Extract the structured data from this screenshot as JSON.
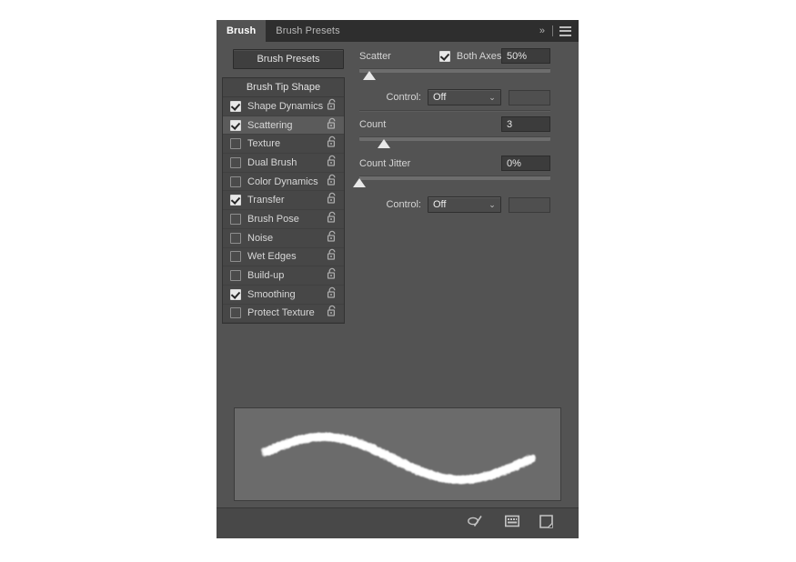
{
  "panel": {
    "tabs": [
      {
        "label": "Brush",
        "active": true
      },
      {
        "label": "Brush Presets",
        "active": false
      }
    ],
    "collapse_icon": "»",
    "menu_icon": "hamburger-menu-icon"
  },
  "left": {
    "presets_button": "Brush Presets",
    "list_header": "Brush Tip Shape",
    "items": [
      {
        "label": "Shape Dynamics",
        "checked": true,
        "selected": false
      },
      {
        "label": "Scattering",
        "checked": true,
        "selected": true
      },
      {
        "label": "Texture",
        "checked": false,
        "selected": false
      },
      {
        "label": "Dual Brush",
        "checked": false,
        "selected": false
      },
      {
        "label": "Color Dynamics",
        "checked": false,
        "selected": false
      },
      {
        "label": "Transfer",
        "checked": true,
        "selected": false
      },
      {
        "label": "Brush Pose",
        "checked": false,
        "selected": false
      },
      {
        "label": "Noise",
        "checked": false,
        "selected": false
      },
      {
        "label": "Wet Edges",
        "checked": false,
        "selected": false
      },
      {
        "label": "Build-up",
        "checked": false,
        "selected": false
      },
      {
        "label": "Smoothing",
        "checked": true,
        "selected": false
      },
      {
        "label": "Protect Texture",
        "checked": false,
        "selected": false
      }
    ]
  },
  "scattering": {
    "scatter": {
      "label": "Scatter",
      "both_axes_label": "Both Axes",
      "both_axes_checked": true,
      "value": "50%",
      "slider_percent": 5
    },
    "scatter_control": {
      "label": "Control:",
      "value": "Off",
      "caret": "⌄",
      "extra_value": ""
    },
    "count": {
      "label": "Count",
      "value": "3",
      "slider_percent": 13
    },
    "count_jitter": {
      "label": "Count Jitter",
      "value": "0%",
      "slider_percent": 0
    },
    "count_control": {
      "label": "Control:",
      "value": "Off",
      "caret": "⌄",
      "extra_value": ""
    }
  },
  "footer": {
    "icons": [
      {
        "name": "toggle-brush-preview-icon"
      },
      {
        "name": "new-brush-preset-icon"
      },
      {
        "name": "create-new-brush-icon"
      }
    ]
  },
  "colors": {
    "panel_bg": "#535353",
    "tabbar_bg": "#2e2e2e",
    "list_bg": "#474747",
    "selected_row": "#5b5b5b",
    "field_bg": "#3c3c3c",
    "preview_bg": "#6b6b6b",
    "text": "#d7d7d7",
    "stroke": "#ffffff"
  }
}
